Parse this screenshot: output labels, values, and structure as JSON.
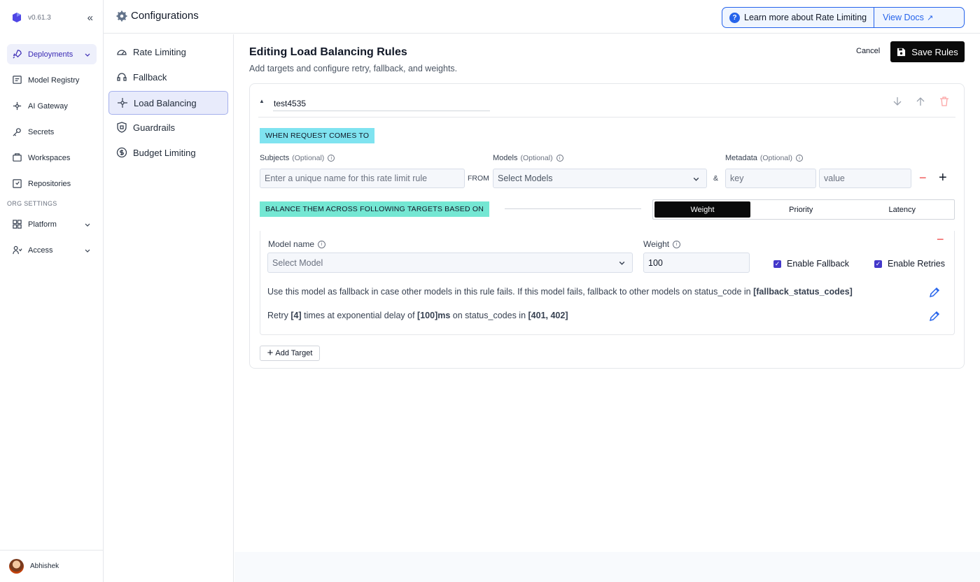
{
  "app": {
    "version": "v0.61.3"
  },
  "sidebar": {
    "items": [
      {
        "label": "Deployments",
        "icon": "rocket-icon"
      },
      {
        "label": "Model Registry",
        "icon": "registry-icon"
      },
      {
        "label": "AI Gateway",
        "icon": "gateway-icon"
      },
      {
        "label": "Secrets",
        "icon": "key-icon"
      },
      {
        "label": "Workspaces",
        "icon": "workspace-icon"
      },
      {
        "label": "Repositories",
        "icon": "repository-icon"
      }
    ],
    "org_settings_label": "ORG SETTINGS",
    "org_items": [
      {
        "label": "Platform",
        "icon": "grid-icon"
      },
      {
        "label": "Access",
        "icon": "users-icon"
      }
    ],
    "user": {
      "name": "Abhishek"
    }
  },
  "header": {
    "title": "Configurations",
    "banner_text": "Learn more about Rate Limiting",
    "banner_link": "View Docs"
  },
  "subnav": {
    "items": [
      {
        "label": "Rate Limiting",
        "icon": "gauge-icon"
      },
      {
        "label": "Fallback",
        "icon": "headset-icon"
      },
      {
        "label": "Load Balancing",
        "icon": "load-balance-icon"
      },
      {
        "label": "Guardrails",
        "icon": "shield-icon"
      },
      {
        "label": "Budget Limiting",
        "icon": "dollar-icon"
      }
    ]
  },
  "editor": {
    "title": "Editing Load Balancing Rules",
    "subtitle": "Add targets and configure retry, fallback, and weights.",
    "cancel_label": "Cancel",
    "save_label": "Save Rules",
    "rule_name": "test4535",
    "when_label": "WHEN REQUEST COMES TO",
    "subjects_label": "Subjects",
    "optional": "(Optional)",
    "subjects_placeholder": "Enter a unique name for this rate limit rule",
    "from_label": "FROM",
    "models_label": "Models",
    "models_placeholder": "Select Models",
    "and_label": "&",
    "metadata_label": "Metadata",
    "key_placeholder": "key",
    "value_placeholder": "value",
    "balance_label": "BALANCE THEM ACROSS FOLLOWING TARGETS BASED ON",
    "modes": [
      "Weight",
      "Priority",
      "Latency"
    ],
    "active_mode": "Weight",
    "target": {
      "model_label": "Model name",
      "model_placeholder": "Select Model",
      "weight_label": "Weight",
      "weight_value": "100",
      "enable_fallback": "Enable Fallback",
      "enable_retries": "Enable Retries",
      "fallback_text": "Use this model as fallback in case other models in this rule fails. If this model fails, fallback to other models on status_code in",
      "fallback_codes": "[fallback_status_codes]",
      "retry_text_1": "Retry",
      "retry_count": "[4]",
      "retry_text_2": "times at exponential delay of",
      "retry_delay": "[100]ms",
      "retry_text_3": "on status_codes in",
      "retry_codes": "[401, 402]"
    },
    "add_target_label": "Add Target"
  },
  "colors": {
    "accent": "#4338ca",
    "link": "#2563eb",
    "tag_cyan": "#7fe3f0",
    "tag_teal": "#74e7d3"
  }
}
